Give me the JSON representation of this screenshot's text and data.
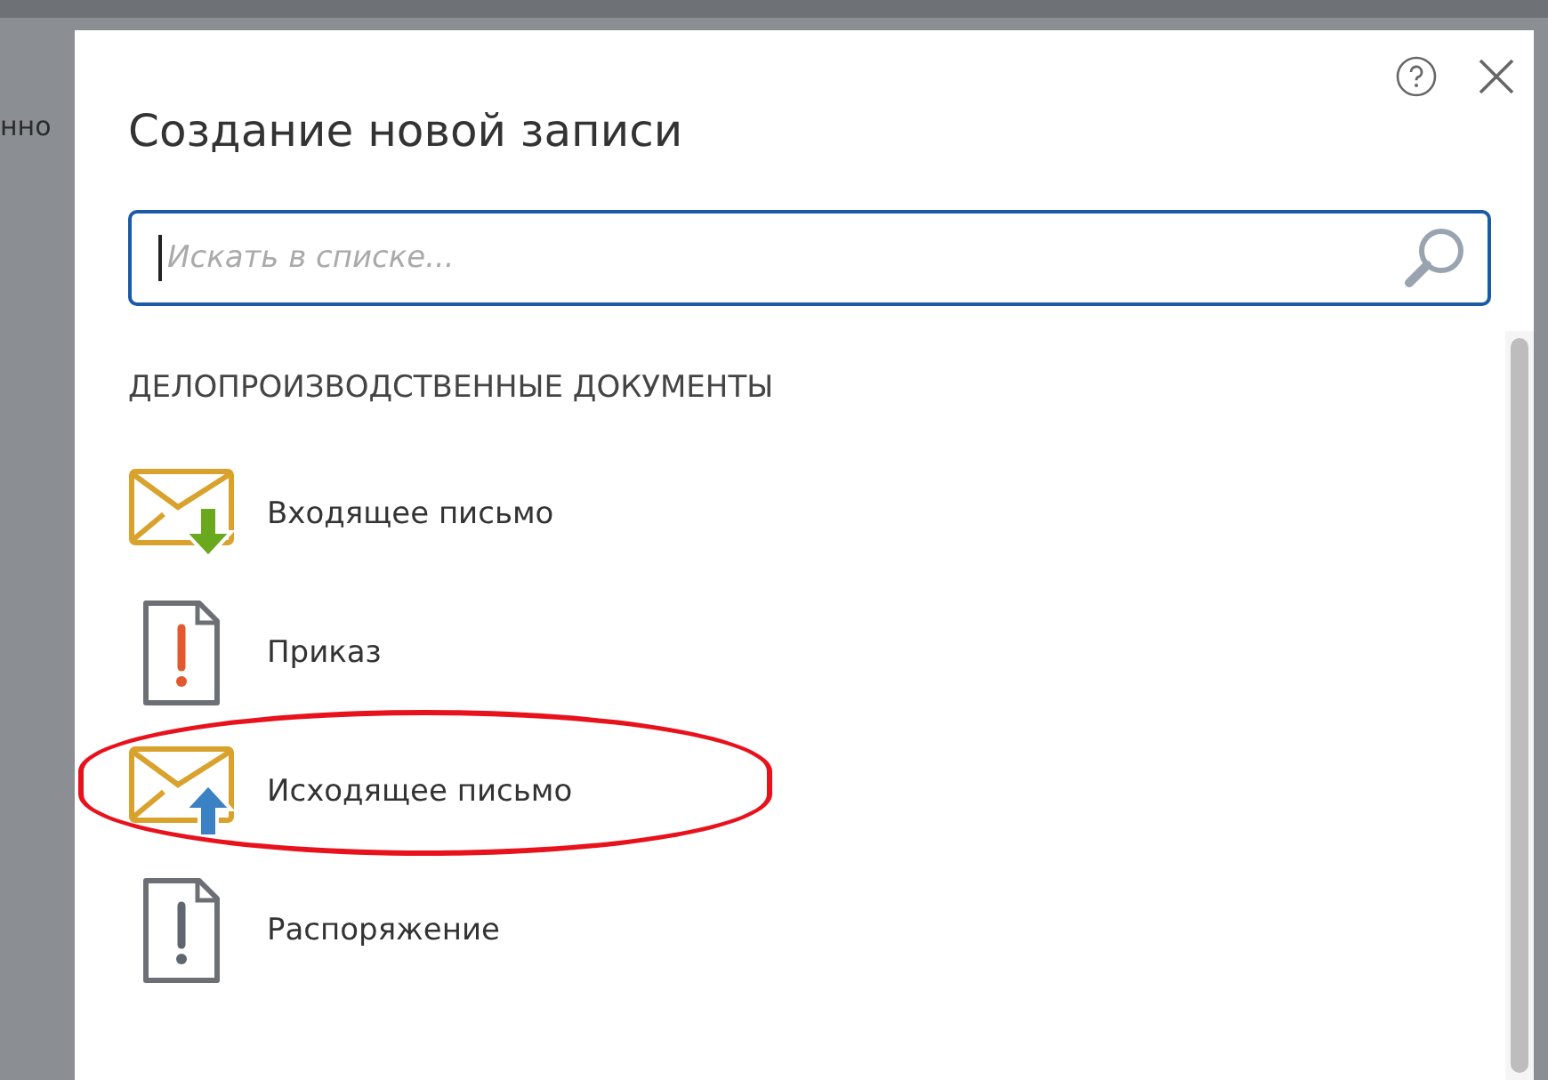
{
  "background_text": "нно",
  "dialog": {
    "title": "Создание новой записи",
    "search": {
      "placeholder": "Искать в списке..."
    },
    "section": "ДЕЛОПРОИЗВОДСТВЕННЫЕ ДОКУМЕНТЫ",
    "items": [
      {
        "kind": "incoming",
        "label": "Входящее письмо",
        "highlighted": false
      },
      {
        "kind": "order",
        "label": "Приказ",
        "highlighted": false
      },
      {
        "kind": "outgoing",
        "label": "Исходящее письмо",
        "highlighted": true
      },
      {
        "kind": "instruction",
        "label": "Распоряжение",
        "highlighted": false
      }
    ]
  }
}
